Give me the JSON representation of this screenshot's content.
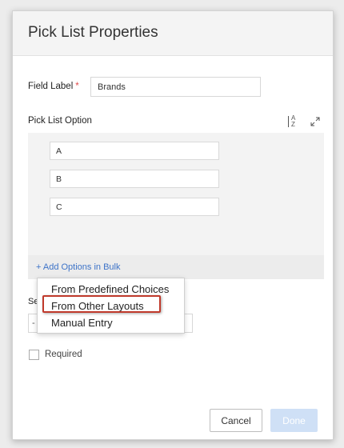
{
  "dialog": {
    "title": "Pick List Properties"
  },
  "field_label": {
    "label": "Field Label",
    "required_mark": "*",
    "value": "Brands"
  },
  "pick_list": {
    "section_label": "Pick List Option",
    "sort_icon_text": {
      "a": "A",
      "z": "Z"
    },
    "options": [
      "A",
      "B",
      "C"
    ],
    "bulk_link": "+ Add Options in Bulk"
  },
  "bulk_menu": {
    "items": [
      "From Predefined Choices",
      "From Other Layouts",
      "Manual Entry"
    ],
    "highlighted": "From Other Layouts"
  },
  "obscured": {
    "label_fragment": "Se",
    "select_fragment": "-"
  },
  "required": {
    "label": "Required",
    "checked": false
  },
  "footer": {
    "cancel_label": "Cancel",
    "done_label": "Done"
  },
  "colors": {
    "link": "#3d73c8",
    "highlight_border": "#c0392b",
    "done_disabled": "#cfe0f6",
    "required_star": "#e04b4b"
  }
}
